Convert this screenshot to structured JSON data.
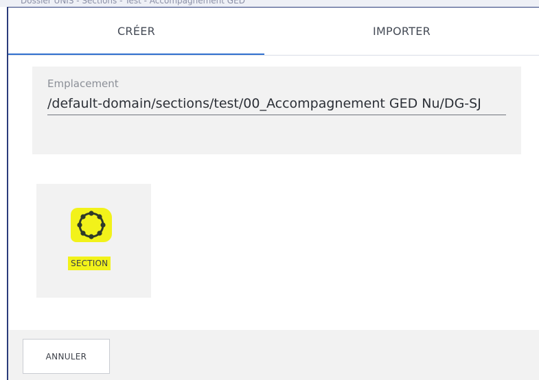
{
  "background_window": {
    "title_fragment": "Dossier UNIS - Sections - Test - Accompagnement GED"
  },
  "tabs": [
    {
      "label": "CRÉER",
      "active": true
    },
    {
      "label": "IMPORTER",
      "active": false
    }
  ],
  "location": {
    "label": "Emplacement",
    "value": "/default-domain/sections/test/00_Accompagnement GED Nu/DG-SJ"
  },
  "document_types": [
    {
      "label": "SECTION",
      "icon": "section-ring-icon",
      "highlight_color": "#f2f21a"
    }
  ],
  "footer": {
    "cancel_label": "ANNULER"
  },
  "colors": {
    "active_tab_underline": "#2f6fcf",
    "dialog_border": "#2a3b7a",
    "panel_bg": "#f2f2f2",
    "highlight": "#f2f21a"
  }
}
